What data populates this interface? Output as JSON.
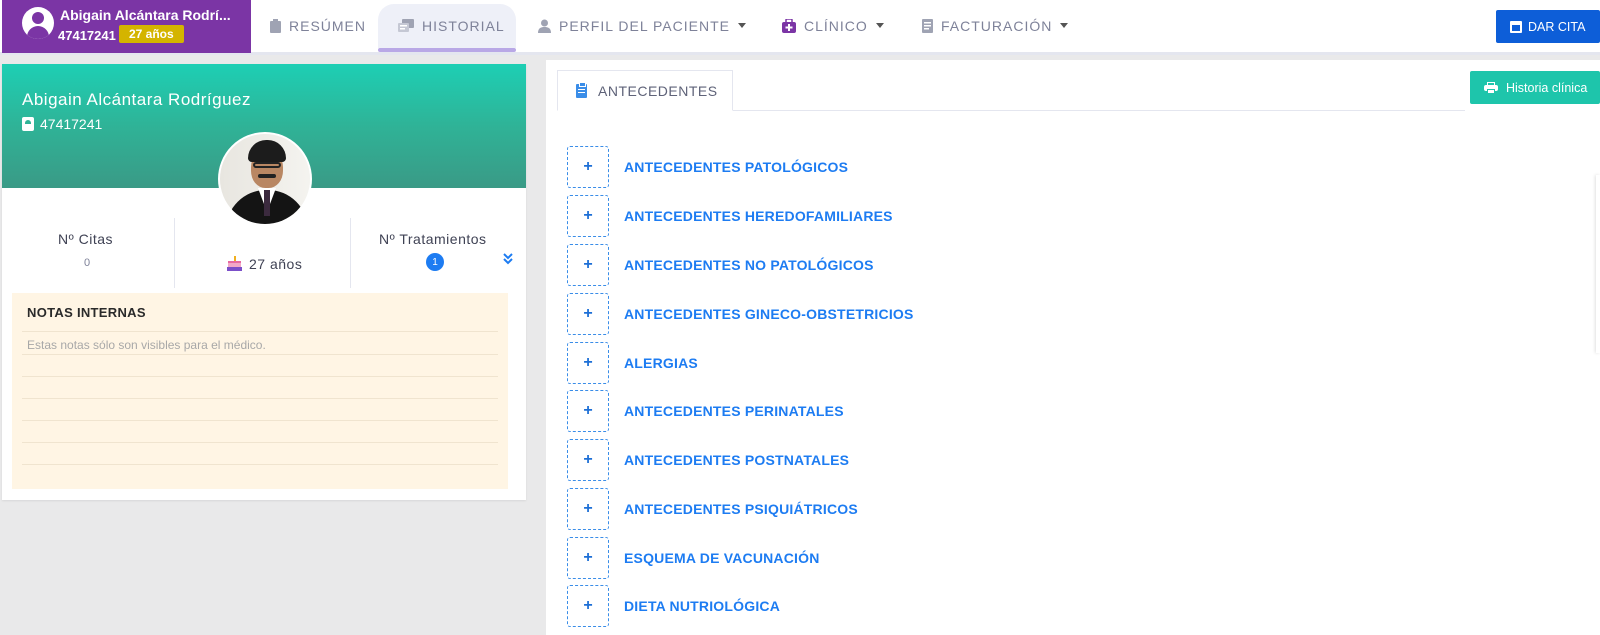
{
  "patient_chip": {
    "name": "Abigain Alcántara Rodrí...",
    "document": "47417241",
    "age_badge": "27 años"
  },
  "nav": {
    "items": [
      {
        "label": "RESÚMEN",
        "icon": "clipboard-icon",
        "active": false,
        "has_caret": false
      },
      {
        "label": "HISTORIAL",
        "icon": "history-icon",
        "active": true,
        "has_caret": false
      },
      {
        "label": "PERFIL DEL PACIENTE",
        "icon": "user-icon",
        "active": false,
        "has_caret": true
      },
      {
        "label": "CLÍNICO",
        "icon": "medkit-icon",
        "active": false,
        "has_caret": true
      },
      {
        "label": "FACTURACIÓN",
        "icon": "invoice-icon",
        "active": false,
        "has_caret": true
      }
    ],
    "dar_cita_label": "DAR CITA"
  },
  "profile": {
    "name": "Abigain Alcántara Rodríguez",
    "document": "47417241",
    "citas_label": "Nº Citas",
    "citas_value": "0",
    "age": "27 años",
    "tratamientos_label": "Nº Tratamientos",
    "tratamientos_value": "1"
  },
  "notes": {
    "title": "NOTAS INTERNAS",
    "placeholder": "Estas notas sólo son visibles para el médico."
  },
  "content": {
    "tab_label": "ANTECEDENTES",
    "historia_button": "Historia clínica",
    "sections": [
      {
        "label": "ANTECEDENTES PATOLÓGICOS",
        "toggle": "+"
      },
      {
        "label": "ANTECEDENTES HEREDOFAMILIARES",
        "toggle": "+"
      },
      {
        "label": "ANTECEDENTES NO PATOLÓGICOS",
        "toggle": "+"
      },
      {
        "label": "ANTECEDENTES GINECO-OBSTETRICIOS",
        "toggle": "+"
      },
      {
        "label": "ALERGIAS",
        "toggle": "+"
      },
      {
        "label": "ANTECEDENTES PERINATALES",
        "toggle": "+"
      },
      {
        "label": "ANTECEDENTES POSTNATALES",
        "toggle": "+"
      },
      {
        "label": "ANTECEDENTES PSIQUIÁTRICOS",
        "toggle": "+"
      },
      {
        "label": "ESQUEMA DE VACUNACIÓN",
        "toggle": "+"
      },
      {
        "label": "DIETA NUTRIOLÓGICA",
        "toggle": "+"
      }
    ]
  },
  "colors": {
    "patient_chip_bg": "#7b35a5",
    "age_badge_bg": "#d4b400",
    "primary_blue": "#0d5ed8",
    "teal": "#1ec5ab",
    "link_blue": "#1d7cf2",
    "notes_bg": "#fff5e4"
  }
}
